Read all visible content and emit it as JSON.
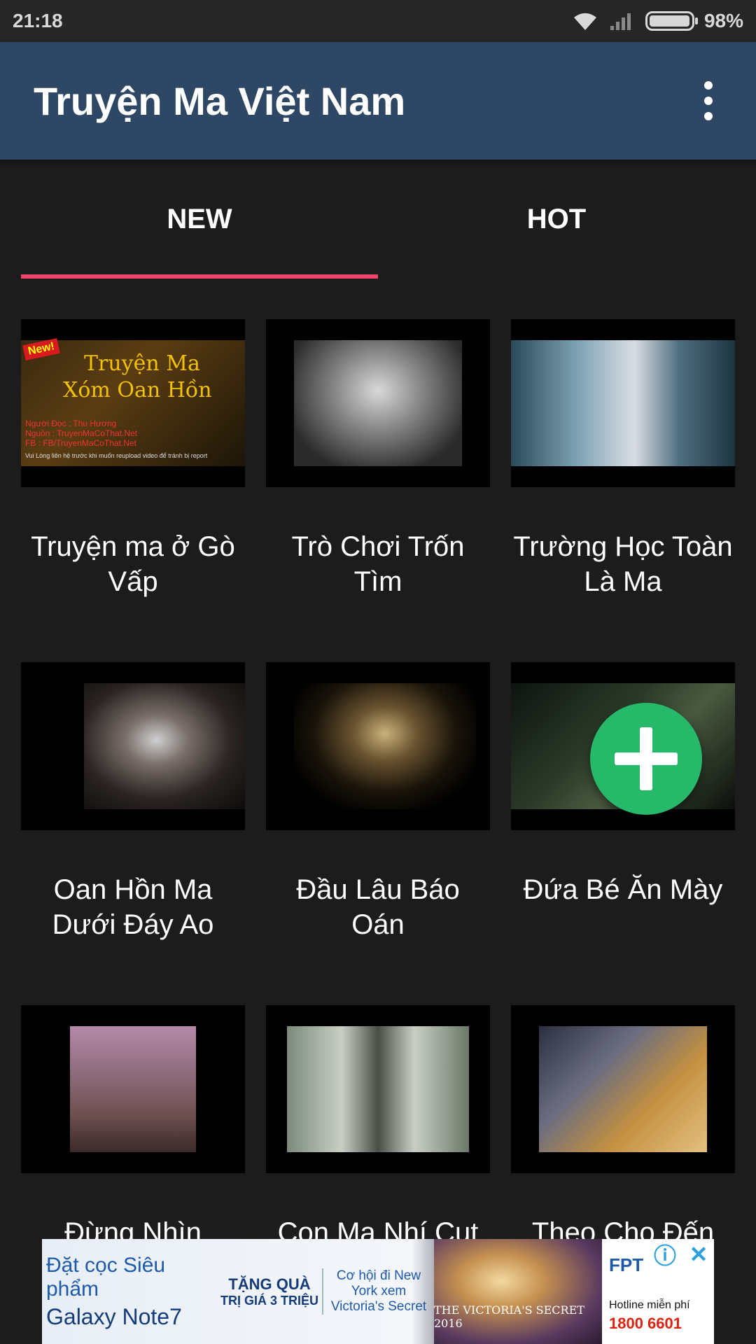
{
  "status_bar": {
    "time": "21:18",
    "battery": "98%",
    "battery_level": 0.98
  },
  "app_bar": {
    "title": "Truyện Ma Việt Nam"
  },
  "tabs": [
    {
      "label": "NEW",
      "active": true
    },
    {
      "label": "HOT",
      "active": false
    }
  ],
  "stories": [
    {
      "title": "Truyện ma ở Gò Vấp"
    },
    {
      "title": "Trò Chơi Trốn Tìm"
    },
    {
      "title": "Trường Học Toàn Là Ma"
    },
    {
      "title": "Oan Hồn Ma Dưới Đáy Ao"
    },
    {
      "title": "Đầu Lâu Báo Oán"
    },
    {
      "title": "Đứa Bé Ăn Mày"
    },
    {
      "title": "Đừng Nhìn"
    },
    {
      "title": "Con Ma Nhí Cụt"
    },
    {
      "title": "Theo Cho Đến"
    }
  ],
  "thumb_1": {
    "badge": "New!",
    "line1": "Truyện Ma",
    "line2": "Xóm Oan Hồn",
    "small1": "Người Đọc : Thu Hương",
    "small2": "Nguồn : TruyenMaCoThat.Net",
    "small3": "FB : FB/TruyenMaCoThat.Net",
    "small4": "Vui Lòng liên hệ trước khi muốn reupload video để tránh bị report"
  },
  "ad": {
    "line1": "Đặt cọc Siêu phẩm",
    "line2": "Galaxy Note7",
    "gift1": "TẶNG QUÀ",
    "gift2": "TRỊ GIÁ 3 TRIỆU",
    "offer": "Cơ hội đi New York xem Victoria's Secret",
    "vs_text": "THE VICTORIA'S SECRET 2016",
    "brand": "FPT",
    "hotline_label": "Hotline miễn phí",
    "hotline": "1800 6601",
    "info_icon": "ⓘ",
    "close_icon": "✕"
  }
}
